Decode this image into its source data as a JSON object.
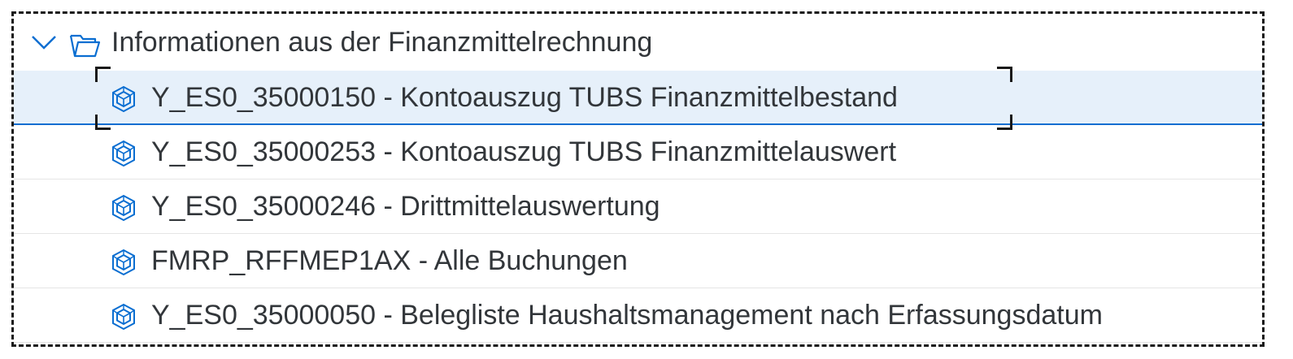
{
  "tree": {
    "folder": {
      "label": "Informationen aus der Finanzmittelrechnung",
      "expanded": true,
      "icon": "folder-open-icon",
      "toggle_icon": "chevron-down-icon"
    },
    "items": [
      {
        "label": "Y_ES0_35000150 - Kontoauszug TUBS Finanzmittelbestand",
        "icon": "report-cube-icon",
        "selected": true
      },
      {
        "label": "Y_ES0_35000253 - Kontoauszug TUBS Finanzmittelauswert",
        "icon": "report-cube-icon",
        "selected": false
      },
      {
        "label": "Y_ES0_35000246 - Drittmittelauswertung",
        "icon": "report-cube-icon",
        "selected": false
      },
      {
        "label": "FMRP_RFFMEP1AX - Alle Buchungen",
        "icon": "report-cube-icon",
        "selected": false
      },
      {
        "label": "Y_ES0_35000050 - Belegliste Haushaltsmanagement nach Erfassungsdatum",
        "icon": "report-cube-icon",
        "selected": false
      }
    ]
  },
  "colors": {
    "text": "#32363a",
    "icon_blue": "#0a6ed1",
    "selected_background": "#e6f0fa",
    "selected_border": "#0a6ed1"
  }
}
